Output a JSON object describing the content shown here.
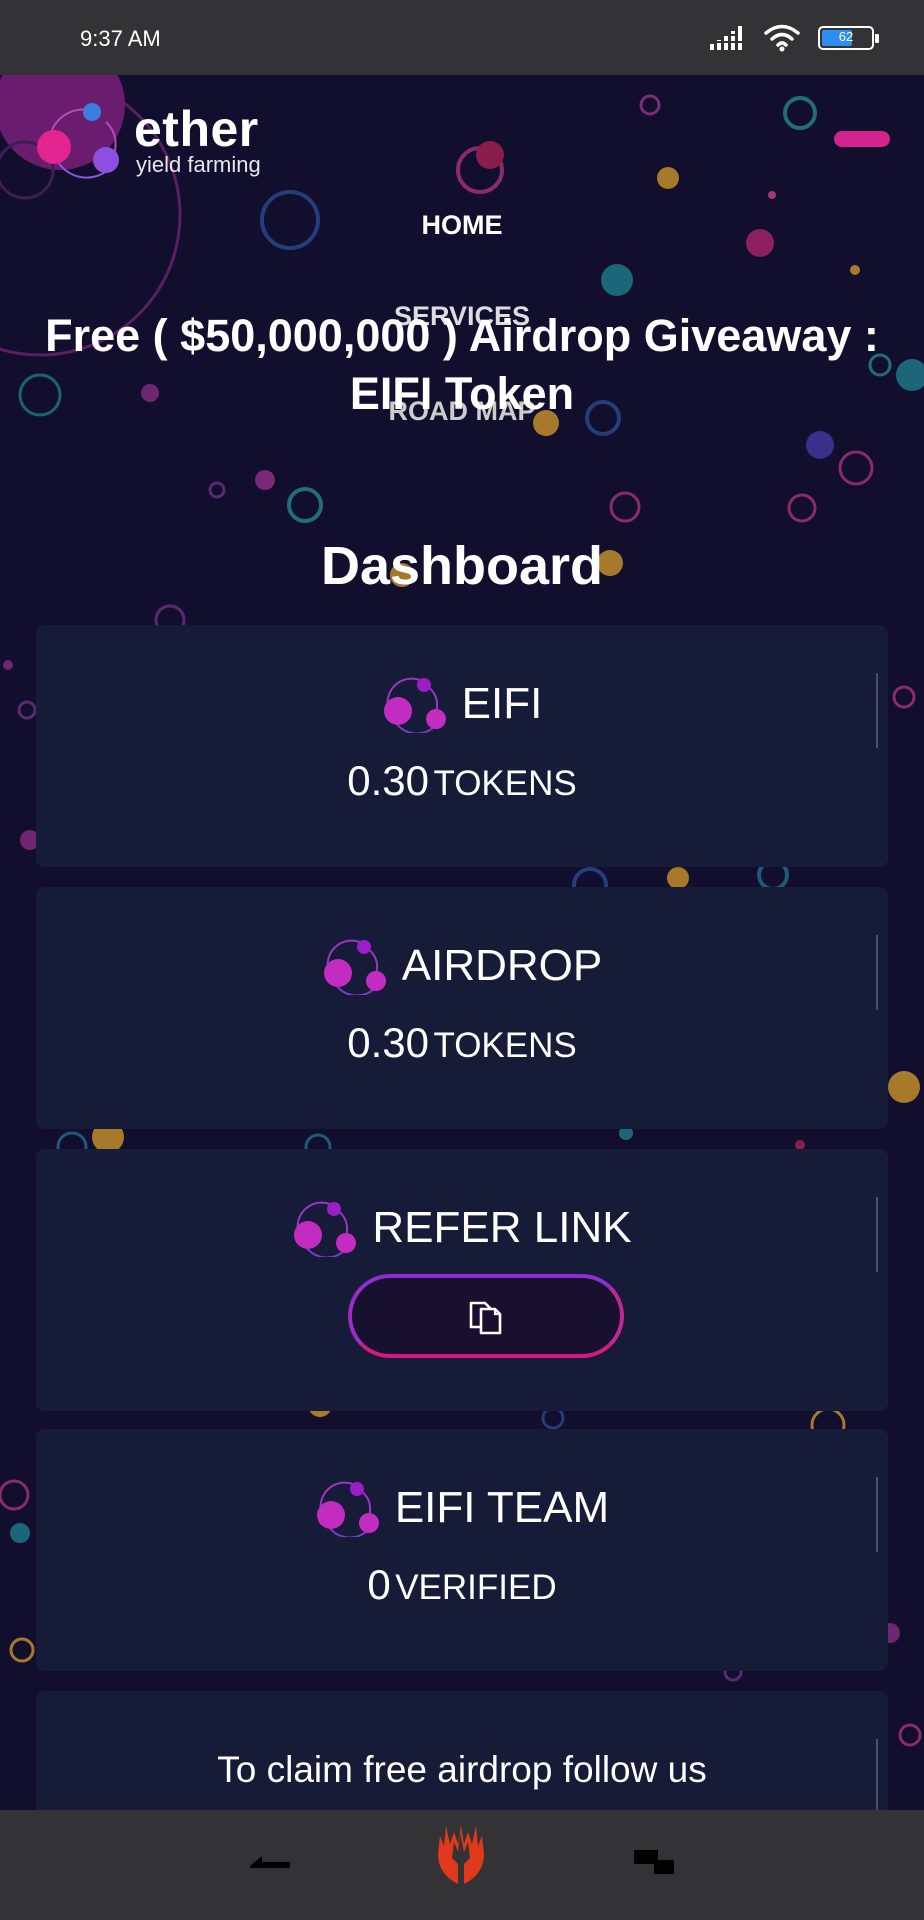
{
  "status_bar": {
    "time": "9:37 AM",
    "battery": "62"
  },
  "header": {
    "logo_word": "ether",
    "logo_sub": "yield farming"
  },
  "nav": {
    "home": "HOME",
    "services": "SERVICES",
    "road_map": "ROAD MAP"
  },
  "headline": "Free ( $50,000,000 ) Airdrop Giveaway : EIFI Token",
  "dashboard": {
    "title": "Dashboard",
    "eifi": {
      "label": "EIFI",
      "value": "0.30",
      "unit": "TOKENS"
    },
    "airdrop": {
      "label": "AIRDROP",
      "value": "0.30",
      "unit": "TOKENS"
    },
    "refer": {
      "label": "REFER LINK"
    },
    "team": {
      "label": "EIFI TEAM",
      "value": "0",
      "unit": "VERIFIED"
    },
    "follow": {
      "text": "To claim free airdrop follow us"
    }
  },
  "colors": {
    "background": "#120e2e",
    "card": "#161b37",
    "accent_pink": "#d2238f",
    "accent_purple": "#8a2fd6",
    "bar": "#333335"
  },
  "icons": [
    "signal-icon",
    "wifi-icon",
    "battery-icon",
    "ether-logo-icon",
    "token-icon",
    "copy-icon",
    "back-icon",
    "home-icon",
    "recents-icon"
  ]
}
